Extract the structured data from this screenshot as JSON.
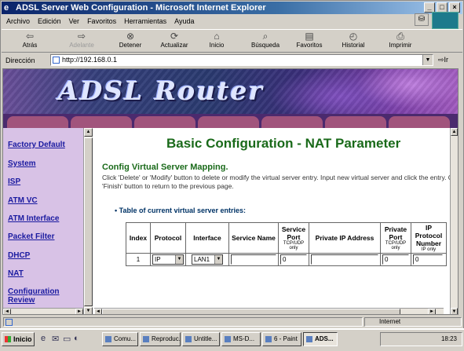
{
  "window": {
    "title": "ADSL Server Web Configuration - Microsoft Internet Explorer",
    "buttons": [
      "_",
      "□",
      "×"
    ]
  },
  "menu": [
    "Archivo",
    "Edición",
    "Ver",
    "Favoritos",
    "Herramientas",
    "Ayuda"
  ],
  "toolbar": [
    {
      "label": "Atrás",
      "icon": "back-arrow-icon",
      "enabled": true
    },
    {
      "label": "Adelante",
      "icon": "forward-arrow-icon",
      "enabled": false
    },
    {
      "label": "Detener",
      "icon": "stop-icon",
      "enabled": true
    },
    {
      "label": "Actualizar",
      "icon": "refresh-icon",
      "enabled": true
    },
    {
      "label": "Inicio",
      "icon": "home-icon",
      "enabled": true
    },
    {
      "label": "Búsqueda",
      "icon": "search-icon",
      "enabled": true
    },
    {
      "label": "Favoritos",
      "icon": "favorites-icon",
      "enabled": true
    },
    {
      "label": "Historial",
      "icon": "history-icon",
      "enabled": true
    },
    {
      "label": "Imprimir",
      "icon": "print-icon",
      "enabled": true
    }
  ],
  "address": {
    "label": "Dirección",
    "url": "http://192.168.0.1",
    "go": "Ir"
  },
  "banner": {
    "title": "ADSL Router"
  },
  "sidebar": {
    "items": [
      "Factory Default",
      "System",
      "ISP",
      "ATM VC",
      "ATM Interface",
      "Packet Filter",
      "DHCP",
      "NAT",
      "Configuration Review"
    ]
  },
  "main": {
    "heading": "Basic Configuration - NAT Parameter",
    "subheading": "Config Virtual Server Mapping.",
    "description": "Click 'Delete' or 'Modify' button to delete or modify the virtual server entry. Input new virtual server and click the entry. Click 'Finish' button to return to the previous page.",
    "bullet": "Table of current virtual server entries:",
    "table": {
      "headers": [
        {
          "text": "Index",
          "sub": ""
        },
        {
          "text": "Protocol",
          "sub": ""
        },
        {
          "text": "Interface",
          "sub": ""
        },
        {
          "text": "Service Name",
          "sub": ""
        },
        {
          "text": "Service Port",
          "sub": "TCP/UDP only"
        },
        {
          "text": "Private IP Address",
          "sub": ""
        },
        {
          "text": "Private Port",
          "sub": "TCP/UDP only"
        },
        {
          "text": "IP Protocol Number",
          "sub": "IP only"
        }
      ],
      "row": {
        "index": "1",
        "protocol": "IP",
        "interface": "LAN1",
        "service_name": "",
        "service_port": "0",
        "private_ip": "",
        "private_port": "0",
        "ip_protocol": "0"
      }
    }
  },
  "status": {
    "zone": "Internet"
  },
  "taskbar": {
    "start": "Inicio",
    "tasks": [
      "Comu...",
      "Reproduc...",
      "Untitle...",
      "MS-D...",
      "6 - Paint",
      "ADS..."
    ],
    "active_task": "ADS...",
    "clock": "18:23"
  }
}
